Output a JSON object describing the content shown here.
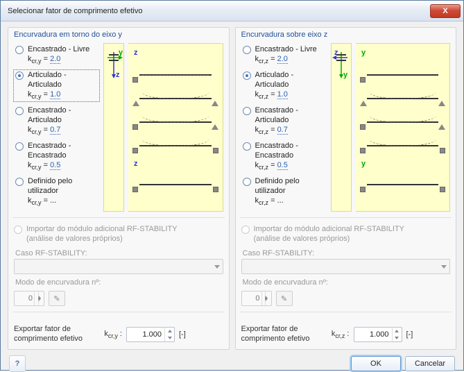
{
  "title": "Selecionar fator de comprimento efetivo",
  "close": "X",
  "panels": [
    {
      "title": "Encurvadura em torno do eixo y",
      "axis_primary": "y",
      "axis_secondary": "z",
      "selected": 1,
      "options": [
        {
          "label": "Encastrado - Livre",
          "k_label": "k",
          "k_sub": "cr,y",
          "k_eq": " = ",
          "k_val": "2.0"
        },
        {
          "label": "Articulado - Articulado",
          "k_label": "k",
          "k_sub": "cr,y",
          "k_eq": " = ",
          "k_val": "1.0"
        },
        {
          "label": "Encastrado - Articulado",
          "k_label": "k",
          "k_sub": "cr,y",
          "k_eq": " = ",
          "k_val": "0.7"
        },
        {
          "label": "Encastrado - Encastrado",
          "k_label": "k",
          "k_sub": "cr,y",
          "k_eq": " = ",
          "k_val": "0.5"
        },
        {
          "label": "Definido pelo utilizador",
          "k_label": "k",
          "k_sub": "cr,y",
          "k_eq": " = ",
          "k_val": "..."
        }
      ],
      "import_label": "Importar do módulo adicional RF-STABILITY",
      "import_sub": "(análise de valores próprios)",
      "case_label": "Caso RF-STABILITY:",
      "mode_label": "Modo de encurvadura nº:",
      "mode_value": "0",
      "export_label": "Exportar fator de comprimento efetivo",
      "export_k": "k",
      "export_sub": "cr,y",
      "export_colon": " :",
      "export_value": "1.000",
      "export_unit": "[-]"
    },
    {
      "title": "Encurvadura sobre eixo z",
      "axis_primary": "z",
      "axis_secondary": "y",
      "selected": 1,
      "options": [
        {
          "label": "Encastrado - Livre",
          "k_label": "k",
          "k_sub": "cr,z",
          "k_eq": " = ",
          "k_val": "2.0"
        },
        {
          "label": "Articulado - Articulado",
          "k_label": "k",
          "k_sub": "cr,z",
          "k_eq": " = ",
          "k_val": "1.0"
        },
        {
          "label": "Encastrado - Articulado",
          "k_label": "k",
          "k_sub": "cr,z",
          "k_eq": " = ",
          "k_val": "0.7"
        },
        {
          "label": "Encastrado - Encastrado",
          "k_label": "k",
          "k_sub": "cr,z",
          "k_eq": " = ",
          "k_val": "0.5"
        },
        {
          "label": "Definido pelo utilizador",
          "k_label": "k",
          "k_sub": "cr,z",
          "k_eq": " = ",
          "k_val": "..."
        }
      ],
      "import_label": "Importar do módulo adicional RF-STABILITY",
      "import_sub": "(análise de valores próprios)",
      "case_label": "Caso RF-STABILITY:",
      "mode_label": "Modo de encurvadura nº:",
      "mode_value": "0",
      "export_label": "Exportar fator de comprimento efetivo",
      "export_k": "k",
      "export_sub": "cr,z",
      "export_colon": " :",
      "export_value": "1.000",
      "export_unit": "[-]"
    }
  ],
  "footer": {
    "ok": "OK",
    "cancel": "Cancelar",
    "help": "?"
  }
}
